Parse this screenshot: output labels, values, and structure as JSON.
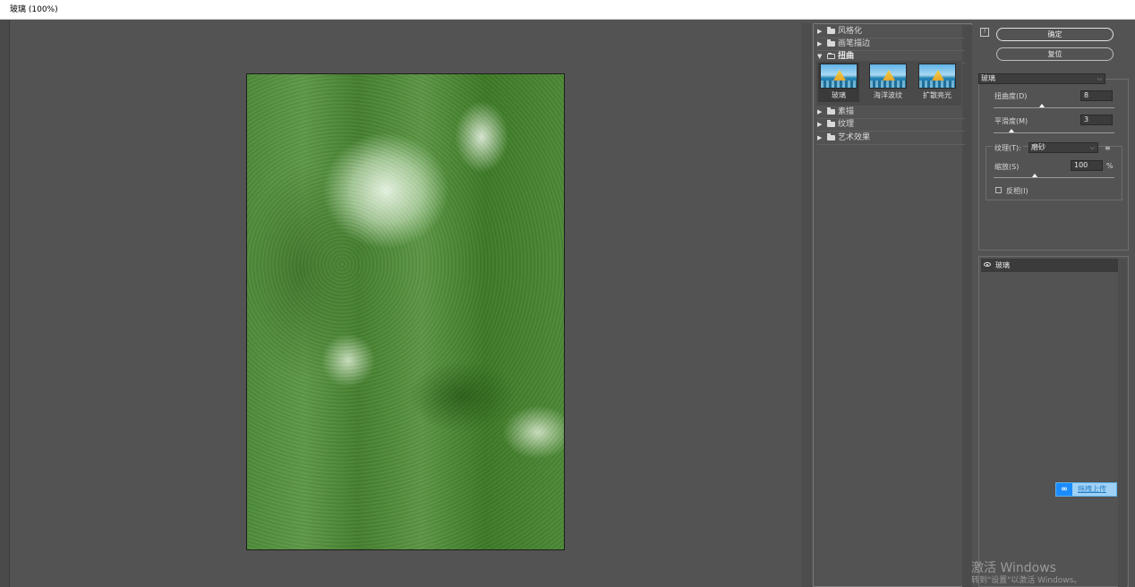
{
  "window": {
    "title": "玻璃 (100%)"
  },
  "gallery": {
    "categories_top": [
      {
        "label": "风格化",
        "state": "collapsed"
      },
      {
        "label": "画笔描边",
        "state": "collapsed"
      },
      {
        "label": "扭曲",
        "state": "expanded"
      }
    ],
    "thumbnails": [
      {
        "label": "玻璃",
        "selected": true
      },
      {
        "label": "海洋波纹",
        "selected": false
      },
      {
        "label": "扩散亮光",
        "selected": false
      }
    ],
    "categories_bottom": [
      {
        "label": "素描",
        "state": "collapsed"
      },
      {
        "label": "纹理",
        "state": "collapsed"
      },
      {
        "label": "艺术效果",
        "state": "collapsed"
      }
    ]
  },
  "actions": {
    "ok_label": "确定",
    "reset_label": "复位",
    "help_glyph": "?"
  },
  "settings": {
    "filter_select": "玻璃",
    "distortion": {
      "label": "扭曲度(D)",
      "value": "8",
      "level_fraction": 0.4
    },
    "smoothness": {
      "label": "平滑度(M)",
      "value": "3",
      "level_fraction": 0.15
    },
    "texture": {
      "label": "纹理(T):",
      "value": "磨砂",
      "menu_icon": "≡"
    },
    "scaling": {
      "label": "缩放(S)",
      "value": "100",
      "unit": "%",
      "level_fraction": 0.33
    },
    "invert": {
      "label": "反相(I)",
      "checked": false
    }
  },
  "layers": {
    "items": [
      {
        "name": "玻璃",
        "visible": true
      }
    ]
  },
  "upload_widget": {
    "label": "拖拽上传"
  },
  "watermark": {
    "line1": "激活 Windows",
    "line2": "转到\"设置\"以激活 Windows。"
  },
  "colors": {
    "panel_bg": "#535353",
    "upload_accent": "#1a8cff",
    "canvas_green": "#4f8a3c"
  }
}
